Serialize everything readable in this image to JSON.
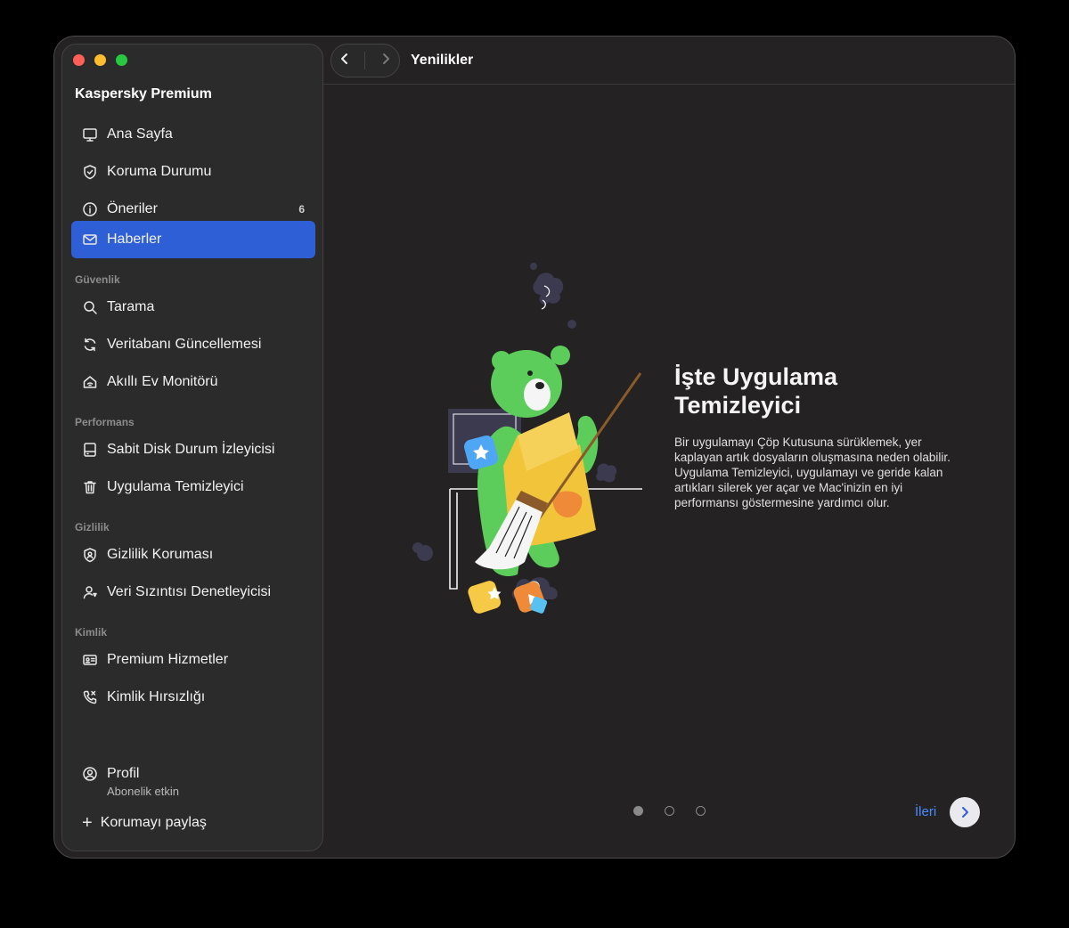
{
  "app": {
    "title": "Kaspersky Premium"
  },
  "sidebar": {
    "main_items": [
      {
        "label": "Ana Sayfa",
        "icon": "monitor-icon"
      },
      {
        "label": "Koruma Durumu",
        "icon": "shield-icon"
      },
      {
        "label": "Öneriler",
        "icon": "info-icon",
        "badge": "6"
      },
      {
        "label": "Haberler",
        "icon": "envelope-icon",
        "active": true
      }
    ],
    "sections": [
      {
        "label": "Güvenlik",
        "items": [
          {
            "label": "Tarama",
            "icon": "search-icon"
          },
          {
            "label": "Veritabanı Güncellemesi",
            "icon": "refresh-icon"
          },
          {
            "label": "Akıllı Ev Monitörü",
            "icon": "home-wifi-icon"
          }
        ]
      },
      {
        "label": "Performans",
        "items": [
          {
            "label": "Sabit Disk Durum İzleyicisi",
            "icon": "disk-icon"
          },
          {
            "label": "Uygulama Temizleyici",
            "icon": "trash-icon"
          }
        ]
      },
      {
        "label": "Gizlilik",
        "items": [
          {
            "label": "Gizlilik Koruması",
            "icon": "privacy-shield-icon"
          },
          {
            "label": "Veri Sızıntısı Denetleyicisi",
            "icon": "user-alert-icon"
          }
        ]
      },
      {
        "label": "Kimlik",
        "items": [
          {
            "label": "Premium Hizmetler",
            "icon": "id-card-icon"
          },
          {
            "label": "Kimlik Hırsızlığı",
            "icon": "phone-icon"
          }
        ]
      }
    ],
    "profile": {
      "name": "Profil",
      "subscription": "Abonelik etkin"
    },
    "share_label": "Korumayı paylaş"
  },
  "header": {
    "title": "Yenilikler"
  },
  "content": {
    "headline": "İşte Uygulama Temizleyici",
    "body": "Bir uygulamayı Çöp Kutusuna sürüklemek, yer kaplayan artık dosyaların oluşmasına neden olabilir. Uygulama Temizleyici, uygulamayı ve geride kalan artıkları silerek yer açar ve Mac'inizin en iyi performansı göstermesine yardımcı olur.",
    "pager": {
      "total": 3,
      "current": 1
    },
    "next_label": "İleri"
  },
  "colors": {
    "accent": "#2e5fd6",
    "link": "#4a8cff",
    "window_bg": "#242222",
    "sidebar_bg": "#2c2b2b"
  }
}
